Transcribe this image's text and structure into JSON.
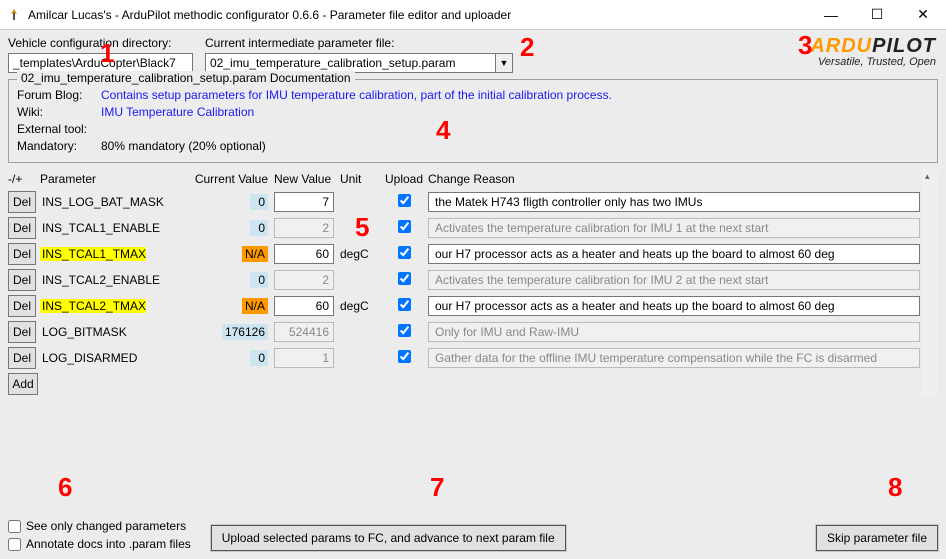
{
  "window": {
    "title": "Amilcar Lucas's - ArduPilot methodic configurator 0.6.6 - Parameter file editor and uploader"
  },
  "top": {
    "dir_label": "Vehicle configuration directory:",
    "dir_value": "_templates\\ArduCopter\\Black7",
    "file_label": "Current intermediate parameter file:",
    "file_value": "02_imu_temperature_calibration_setup.param",
    "logo_main_a": "ARDU",
    "logo_main_b": "PILOT",
    "logo_sub": "Versatile, Trusted, Open"
  },
  "doc": {
    "group_title": "02_imu_temperature_calibration_setup.param Documentation",
    "rows": [
      {
        "label": "Forum Blog:",
        "text": "Contains setup parameters for IMU temperature calibration, part of the initial calibration process.",
        "link": true
      },
      {
        "label": "Wiki:",
        "text": "IMU Temperature Calibration",
        "link": true
      },
      {
        "label": "External tool:",
        "text": "",
        "link": false
      },
      {
        "label": "Mandatory:",
        "text": "80% mandatory (20% optional)",
        "link": false
      }
    ]
  },
  "headers": {
    "delcol": "-/+",
    "param": "Parameter",
    "cur": "Current Value",
    "nv": "New Value",
    "unit": "Unit",
    "upload": "Upload",
    "reason": "Change Reason"
  },
  "rows": [
    {
      "del": "Del",
      "param": "INS_LOG_BAT_MASK",
      "hl": false,
      "cur": "0",
      "na": false,
      "nv": "7",
      "nv_disabled": false,
      "unit": "",
      "up": true,
      "reason": "the Matek H743 fligth controller only has two IMUs",
      "reason_disabled": false
    },
    {
      "del": "Del",
      "param": "INS_TCAL1_ENABLE",
      "hl": false,
      "cur": "0",
      "na": false,
      "nv": "2",
      "nv_disabled": true,
      "unit": "",
      "up": true,
      "reason": "Activates the temperature calibration for IMU 1 at the next start",
      "reason_disabled": true
    },
    {
      "del": "Del",
      "param": "INS_TCAL1_TMAX",
      "hl": true,
      "cur": "N/A",
      "na": true,
      "nv": "60",
      "nv_disabled": false,
      "unit": "degC",
      "up": true,
      "reason": "our H7 processor acts as a heater and heats up the board to almost 60 deg",
      "reason_disabled": false
    },
    {
      "del": "Del",
      "param": "INS_TCAL2_ENABLE",
      "hl": false,
      "cur": "0",
      "na": false,
      "nv": "2",
      "nv_disabled": true,
      "unit": "",
      "up": true,
      "reason": "Activates the temperature calibration for IMU 2 at the next start",
      "reason_disabled": true
    },
    {
      "del": "Del",
      "param": "INS_TCAL2_TMAX",
      "hl": true,
      "cur": "N/A",
      "na": true,
      "nv": "60",
      "nv_disabled": false,
      "unit": "degC",
      "up": true,
      "reason": "our H7 processor acts as a heater and heats up the board to almost 60 deg",
      "reason_disabled": false
    },
    {
      "del": "Del",
      "param": "LOG_BITMASK",
      "hl": false,
      "cur": "176126",
      "na": false,
      "nv": "524416",
      "nv_disabled": true,
      "unit": "",
      "up": true,
      "reason": "Only for IMU and Raw-IMU",
      "reason_disabled": true
    },
    {
      "del": "Del",
      "param": "LOG_DISARMED",
      "hl": false,
      "cur": "0",
      "na": false,
      "nv": "1",
      "nv_disabled": true,
      "unit": "",
      "up": true,
      "reason": "Gather data for the offline IMU temperature compensation while the FC is disarmed",
      "reason_disabled": true
    }
  ],
  "add_label": "Add",
  "bottom": {
    "see_changed": "See only changed parameters",
    "annotate": "Annotate docs into .param files",
    "upload": "Upload selected params to FC, and advance to next param file",
    "skip": "Skip parameter file"
  },
  "annotations": {
    "a1": "1",
    "a2": "2",
    "a3": "3",
    "a4": "4",
    "a5": "5",
    "a6": "6",
    "a7": "7",
    "a8": "8"
  }
}
